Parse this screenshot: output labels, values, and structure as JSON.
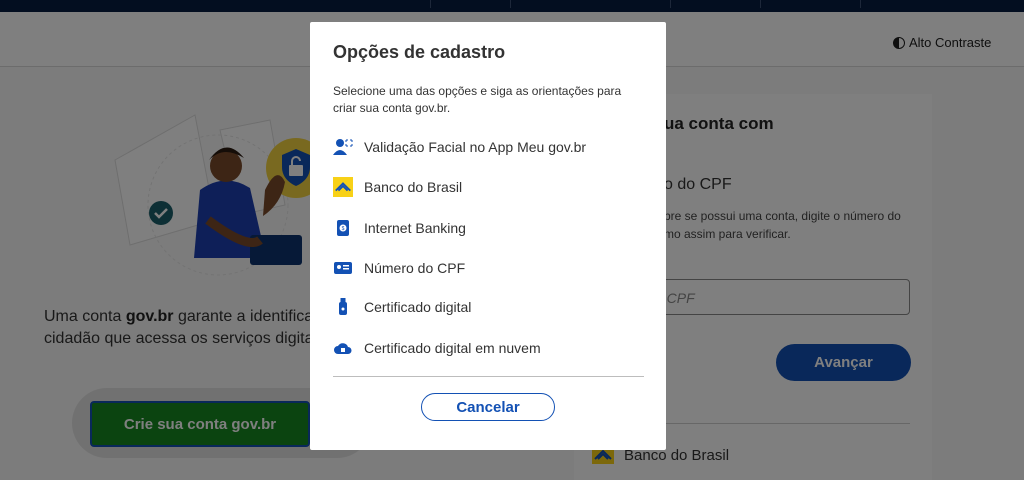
{
  "header": {
    "contrast_label": "Alto Contraste"
  },
  "left": {
    "intro_line1_prefix": "Uma conta ",
    "intro_brand": "gov.br",
    "intro_line1_suffix": " garante a identificaçã",
    "intro_line2": "cidadão que acessa os serviços digitais",
    "create_button": "Crie sua conta gov.br"
  },
  "card": {
    "title": "ua conta com",
    "subtitle": "o do CPF",
    "description": "bre se possui uma conta, digite o número do mo assim para verificar.",
    "cpf_placeholder": "u CPF",
    "advance_button": "Avançar",
    "bank_label": "Banco do Brasil"
  },
  "modal": {
    "title": "Opções de cadastro",
    "description": "Selecione uma das opções e siga as orientações para criar sua conta gov.br.",
    "options": [
      {
        "label": "Validação Facial no App Meu gov.br",
        "icon": "face-id-icon"
      },
      {
        "label": "Banco do Brasil",
        "icon": "banco-do-brasil-icon"
      },
      {
        "label": "Internet Banking",
        "icon": "internet-banking-icon"
      },
      {
        "label": "Número do CPF",
        "icon": "id-card-icon"
      },
      {
        "label": "Certificado digital",
        "icon": "usb-token-icon"
      },
      {
        "label": "Certificado digital em nuvem",
        "icon": "cloud-certificate-icon"
      }
    ],
    "cancel_button": "Cancelar"
  },
  "colors": {
    "govbr_blue": "#1351b4",
    "govbr_dark": "#071d41",
    "govbr_green": "#168821",
    "bb_yellow": "#f8d117"
  }
}
